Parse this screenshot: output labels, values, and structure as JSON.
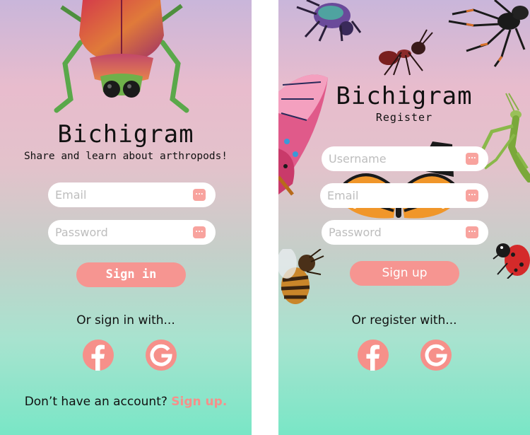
{
  "login": {
    "title": "Bichigram",
    "tagline": "Share and learn about arthropods!",
    "email_placeholder": "Email",
    "password_placeholder": "Password",
    "signin_label": "Sign in",
    "alt_text": "Or sign in with...",
    "footer_text": "Don’t have an account?",
    "footer_link": "Sign up."
  },
  "register": {
    "title": "Bichigram",
    "subtitle": "Register",
    "username_placeholder": "Username",
    "email_placeholder": "Email",
    "password_placeholder": "Password",
    "signup_label": "Sign up",
    "alt_text": "Or register with..."
  },
  "icons": {
    "field_action": "more-dots-icon",
    "social_1": "facebook-icon",
    "social_2": "google-icon",
    "decor": [
      "beetle-icon",
      "ant-icon",
      "spider-icon",
      "butterfly-icon",
      "mantis-icon",
      "bee-icon",
      "ladybug-icon"
    ]
  },
  "colors": {
    "accent": "#f69591",
    "gradient_top": "#c9b6da",
    "gradient_bottom": "#79e6c6"
  }
}
